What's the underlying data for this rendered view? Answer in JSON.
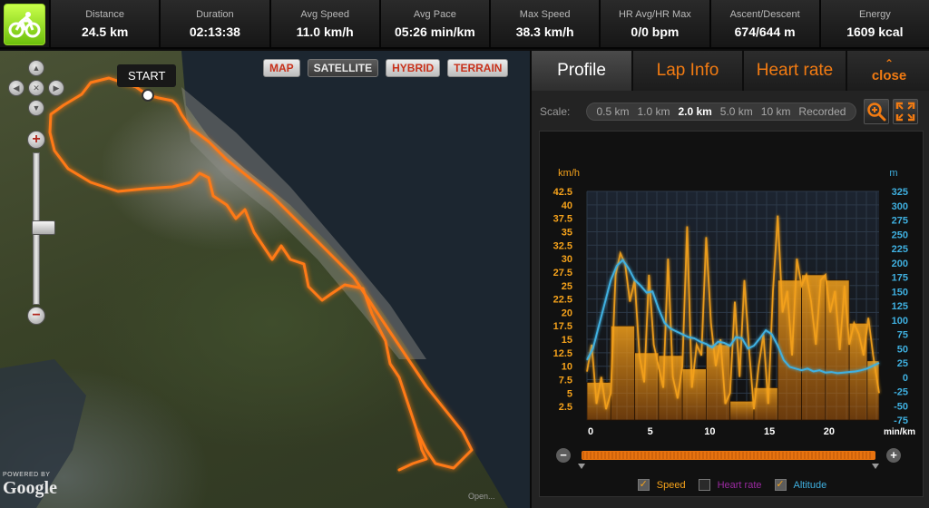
{
  "stats": [
    {
      "label": "Distance",
      "value": "24.5 km"
    },
    {
      "label": "Duration",
      "value": "02:13:38"
    },
    {
      "label": "Avg Speed",
      "value": "11.0 km/h"
    },
    {
      "label": "Avg Pace",
      "value": "05:26 min/km"
    },
    {
      "label": "Max Speed",
      "value": "38.3 km/h"
    },
    {
      "label": "HR Avg/HR Max",
      "value": "0/0 bpm"
    },
    {
      "label": "Ascent/Descent",
      "value": "674/644 m"
    },
    {
      "label": "Energy",
      "value": "1609 kcal"
    }
  ],
  "map": {
    "types": [
      "MAP",
      "SATELLITE",
      "HYBRID",
      "TERRAIN"
    ],
    "active_type": "SATELLITE",
    "start_label": "START",
    "powered_by": "POWERED BY",
    "google": "Google",
    "credit": "Open...",
    "route_color": "#ff7a16"
  },
  "tabs": [
    {
      "label": "Profile",
      "active": true
    },
    {
      "label": "Lap Info",
      "active": false
    },
    {
      "label": "Heart rate",
      "active": false
    }
  ],
  "close_label": "close",
  "scale": {
    "label": "Scale:",
    "options": [
      "0.5 km",
      "1.0 km",
      "2.0 km",
      "5.0 km",
      "10 km",
      "Recorded"
    ],
    "selected": "2.0 km"
  },
  "legend": [
    {
      "label": "Speed",
      "checked": true,
      "color": "#f5a21b"
    },
    {
      "label": "Heart rate",
      "checked": false,
      "color": "#9a2aa0"
    },
    {
      "label": "Altitude",
      "checked": true,
      "color": "#3fb0e0"
    }
  ],
  "chart_data": {
    "type": "bar",
    "ylabel_left": "km/h",
    "ylabel_right": "m",
    "xunit": "min/km",
    "y_left_ticks": [
      2.5,
      5,
      7.5,
      10,
      12.5,
      15,
      17.5,
      20,
      22.5,
      25,
      27.5,
      30,
      32.5,
      35,
      37.5,
      40,
      42.5
    ],
    "y_right_ticks": [
      -75,
      -50,
      -25,
      0,
      25,
      50,
      75,
      100,
      125,
      150,
      175,
      200,
      225,
      250,
      275,
      300,
      325
    ],
    "x_ticks": [
      0,
      5,
      10,
      15,
      20
    ],
    "ylim_left": [
      0,
      42.5
    ],
    "ylim_right": [
      -75,
      325
    ],
    "xlim": [
      0,
      24.5
    ],
    "bars": [
      {
        "x0": 0,
        "x1": 2,
        "value": 7
      },
      {
        "x0": 2,
        "x1": 4,
        "value": 17.5
      },
      {
        "x0": 4,
        "x1": 6,
        "value": 12.5
      },
      {
        "x0": 6,
        "x1": 8,
        "value": 12
      },
      {
        "x0": 8,
        "x1": 10,
        "value": 9.5
      },
      {
        "x0": 10,
        "x1": 12,
        "value": 14
      },
      {
        "x0": 12,
        "x1": 14,
        "value": 3.5
      },
      {
        "x0": 14,
        "x1": 16,
        "value": 6
      },
      {
        "x0": 16,
        "x1": 18,
        "value": 26
      },
      {
        "x0": 18,
        "x1": 20,
        "value": 27
      },
      {
        "x0": 20,
        "x1": 22,
        "value": 26
      },
      {
        "x0": 22,
        "x1": 23.5,
        "value": 18
      },
      {
        "x0": 23.5,
        "x1": 24.5,
        "value": 11
      }
    ],
    "series": [
      {
        "name": "Speed",
        "x": [
          0,
          0.4,
          0.8,
          1.2,
          1.6,
          2.0,
          2.4,
          2.8,
          3.2,
          3.6,
          4.0,
          4.4,
          4.8,
          5.2,
          5.6,
          6.0,
          6.4,
          6.8,
          7.2,
          7.6,
          8.0,
          8.4,
          8.8,
          9.2,
          9.6,
          10.0,
          10.4,
          10.8,
          11.2,
          11.6,
          12.0,
          12.4,
          12.8,
          13.2,
          13.6,
          14.0,
          14.4,
          14.8,
          15.2,
          15.6,
          16.0,
          16.4,
          16.8,
          17.2,
          17.6,
          18.0,
          18.4,
          18.8,
          19.2,
          19.6,
          20.0,
          20.4,
          20.8,
          21.2,
          21.6,
          22.0,
          22.4,
          22.8,
          23.2,
          23.6,
          24.0,
          24.5
        ],
        "values": [
          9,
          14,
          3,
          8,
          2,
          5,
          27,
          31,
          29,
          22,
          26,
          12,
          7,
          27,
          14,
          10,
          6,
          30,
          8,
          4,
          10,
          36,
          6,
          14,
          12,
          34,
          18,
          10,
          15,
          3,
          5,
          22,
          8,
          26,
          13,
          2,
          10,
          16,
          3,
          24,
          38,
          20,
          24,
          12,
          30,
          25,
          27,
          22,
          14,
          26,
          27,
          20,
          24,
          13,
          25,
          14,
          18,
          16,
          12,
          19,
          12,
          5
        ]
      },
      {
        "name": "Altitude",
        "x": [
          0,
          0.5,
          1.0,
          1.5,
          2.0,
          2.5,
          3.0,
          3.5,
          4.0,
          4.5,
          5.0,
          5.5,
          6.0,
          6.5,
          7.0,
          7.5,
          8.0,
          8.5,
          9.0,
          9.5,
          10.0,
          10.5,
          11.0,
          11.5,
          12.0,
          12.5,
          13.0,
          13.5,
          14.0,
          14.5,
          15.0,
          15.5,
          16.0,
          16.5,
          17.0,
          17.5,
          18.0,
          18.5,
          19.0,
          19.5,
          20.0,
          20.5,
          21.0,
          21.5,
          22.0,
          22.5,
          23.0,
          23.5,
          24.0,
          24.5
        ],
        "values": [
          30,
          50,
          90,
          130,
          170,
          195,
          205,
          190,
          170,
          160,
          148,
          150,
          120,
          95,
          85,
          80,
          75,
          70,
          68,
          62,
          58,
          52,
          62,
          60,
          55,
          70,
          68,
          50,
          55,
          68,
          82,
          75,
          55,
          30,
          18,
          15,
          12,
          15,
          10,
          12,
          8,
          9,
          7,
          8,
          9,
          10,
          12,
          15,
          20,
          25
        ]
      }
    ]
  }
}
